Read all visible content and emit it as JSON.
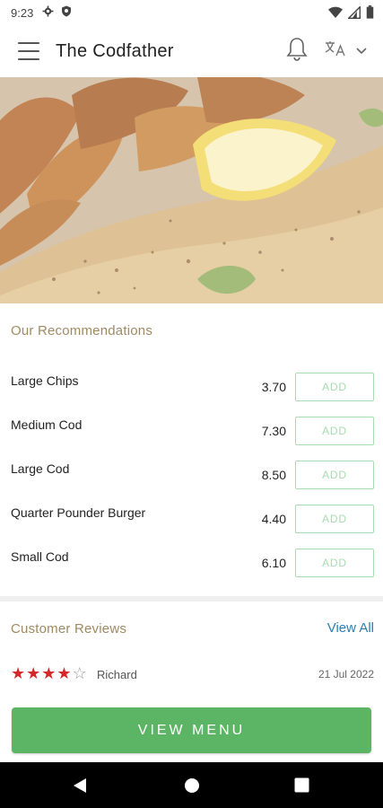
{
  "status_bar": {
    "time": "9:23",
    "icons": [
      "gear-icon",
      "shield-icon",
      "wifi-icon",
      "signal-icon",
      "battery-icon"
    ]
  },
  "app_bar": {
    "title": "The Codfather",
    "icons": [
      "menu-icon",
      "bell-icon",
      "language-icon",
      "chevron-down-icon"
    ]
  },
  "hero": {
    "description_icon": "fish-and-chips-photo"
  },
  "recommendations": {
    "title": "Our Recommendations",
    "add_label": "ADD",
    "items": [
      {
        "name": "Large Chips",
        "price": "3.70"
      },
      {
        "name": "Medium Cod",
        "price": "7.30"
      },
      {
        "name": "Large Cod",
        "price": "8.50"
      },
      {
        "name": "Quarter Pounder Burger",
        "price": "4.40"
      },
      {
        "name": "Small Cod",
        "price": "6.10"
      }
    ]
  },
  "reviews": {
    "title": "Customer Reviews",
    "view_all": "View All",
    "items": [
      {
        "rating": 4,
        "max_rating": 5,
        "reviewer": "Richard",
        "date": "21 Jul 2022"
      }
    ]
  },
  "cta": {
    "label": "VIEW MENU"
  },
  "colors": {
    "accent_green": "#5cb565",
    "add_border": "#a8dcb1",
    "section_title": "#a08a62",
    "link_blue": "#2a7fb0",
    "star_red": "#d62828"
  },
  "nav_bar": {
    "icons": [
      "back-icon",
      "home-icon",
      "recents-icon"
    ]
  }
}
